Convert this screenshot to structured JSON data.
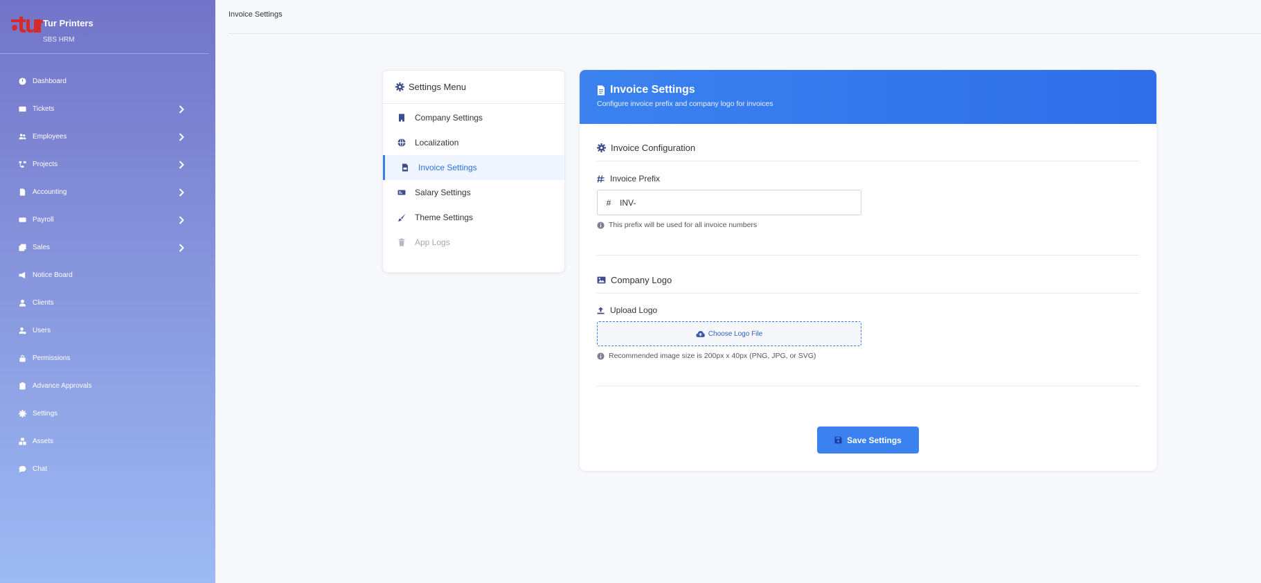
{
  "brand": {
    "name": "Tur Printers",
    "subtitle": "SBS HRM",
    "logo_color": "#d42a2a"
  },
  "sidebar": {
    "items": [
      {
        "label": "Dashboard",
        "icon": "gauge-icon",
        "has_submenu": false
      },
      {
        "label": "Tickets",
        "icon": "ticket-icon",
        "has_submenu": true
      },
      {
        "label": "Employees",
        "icon": "users-icon",
        "has_submenu": true
      },
      {
        "label": "Projects",
        "icon": "project-diagram-icon",
        "has_submenu": true
      },
      {
        "label": "Accounting",
        "icon": "file-invoice-icon",
        "has_submenu": true
      },
      {
        "label": "Payroll",
        "icon": "money-icon",
        "has_submenu": true
      },
      {
        "label": "Sales",
        "icon": "copy-icon",
        "has_submenu": true
      },
      {
        "label": "Notice Board",
        "icon": "bullhorn-icon",
        "has_submenu": false
      },
      {
        "label": "Clients",
        "icon": "user-icon",
        "has_submenu": false
      },
      {
        "label": "Users",
        "icon": "user-cog-icon",
        "has_submenu": false
      },
      {
        "label": "Permissions",
        "icon": "lock-icon",
        "has_submenu": false
      },
      {
        "label": "Advance Approvals",
        "icon": "clipboard-icon",
        "has_submenu": false
      },
      {
        "label": "Settings",
        "icon": "gear-icon",
        "has_submenu": false
      },
      {
        "label": "Assets",
        "icon": "boxes-icon",
        "has_submenu": false
      },
      {
        "label": "Chat",
        "icon": "chat-icon",
        "has_submenu": false
      }
    ]
  },
  "topbar": {
    "breadcrumb": "Invoice Settings"
  },
  "settings_menu": {
    "title": "Settings Menu",
    "items": [
      {
        "label": "Company Settings",
        "icon": "building-icon",
        "state": "normal"
      },
      {
        "label": "Localization",
        "icon": "globe-icon",
        "state": "normal"
      },
      {
        "label": "Invoice Settings",
        "icon": "file-invoice-icon",
        "state": "active"
      },
      {
        "label": "Salary Settings",
        "icon": "money-check-icon",
        "state": "normal"
      },
      {
        "label": "Theme Settings",
        "icon": "paint-brush-icon",
        "state": "normal"
      },
      {
        "label": "App Logs",
        "icon": "trash-icon",
        "state": "disabled"
      }
    ]
  },
  "main": {
    "title": "Invoice Settings",
    "description": "Configure invoice prefix and company logo for invoices",
    "invoice_config": {
      "title": "Invoice Configuration",
      "prefix_label": "Invoice Prefix",
      "prefix_value": "INV-",
      "prefix_symbol": "#",
      "prefix_help": "This prefix will be used for all invoice numbers"
    },
    "company_logo": {
      "title": "Company Logo",
      "upload_label": "Upload Logo",
      "upload_button": "Choose Logo File",
      "upload_help": "Recommended image size is 200px x 40px (PNG, JPG, or SVG)"
    },
    "save_button": "Save Settings"
  },
  "colors": {
    "accent": "#3b82f0",
    "sidebar_top": "#7274c9",
    "sidebar_bottom": "#9dbaf4",
    "icon": "#3f4d8c"
  }
}
